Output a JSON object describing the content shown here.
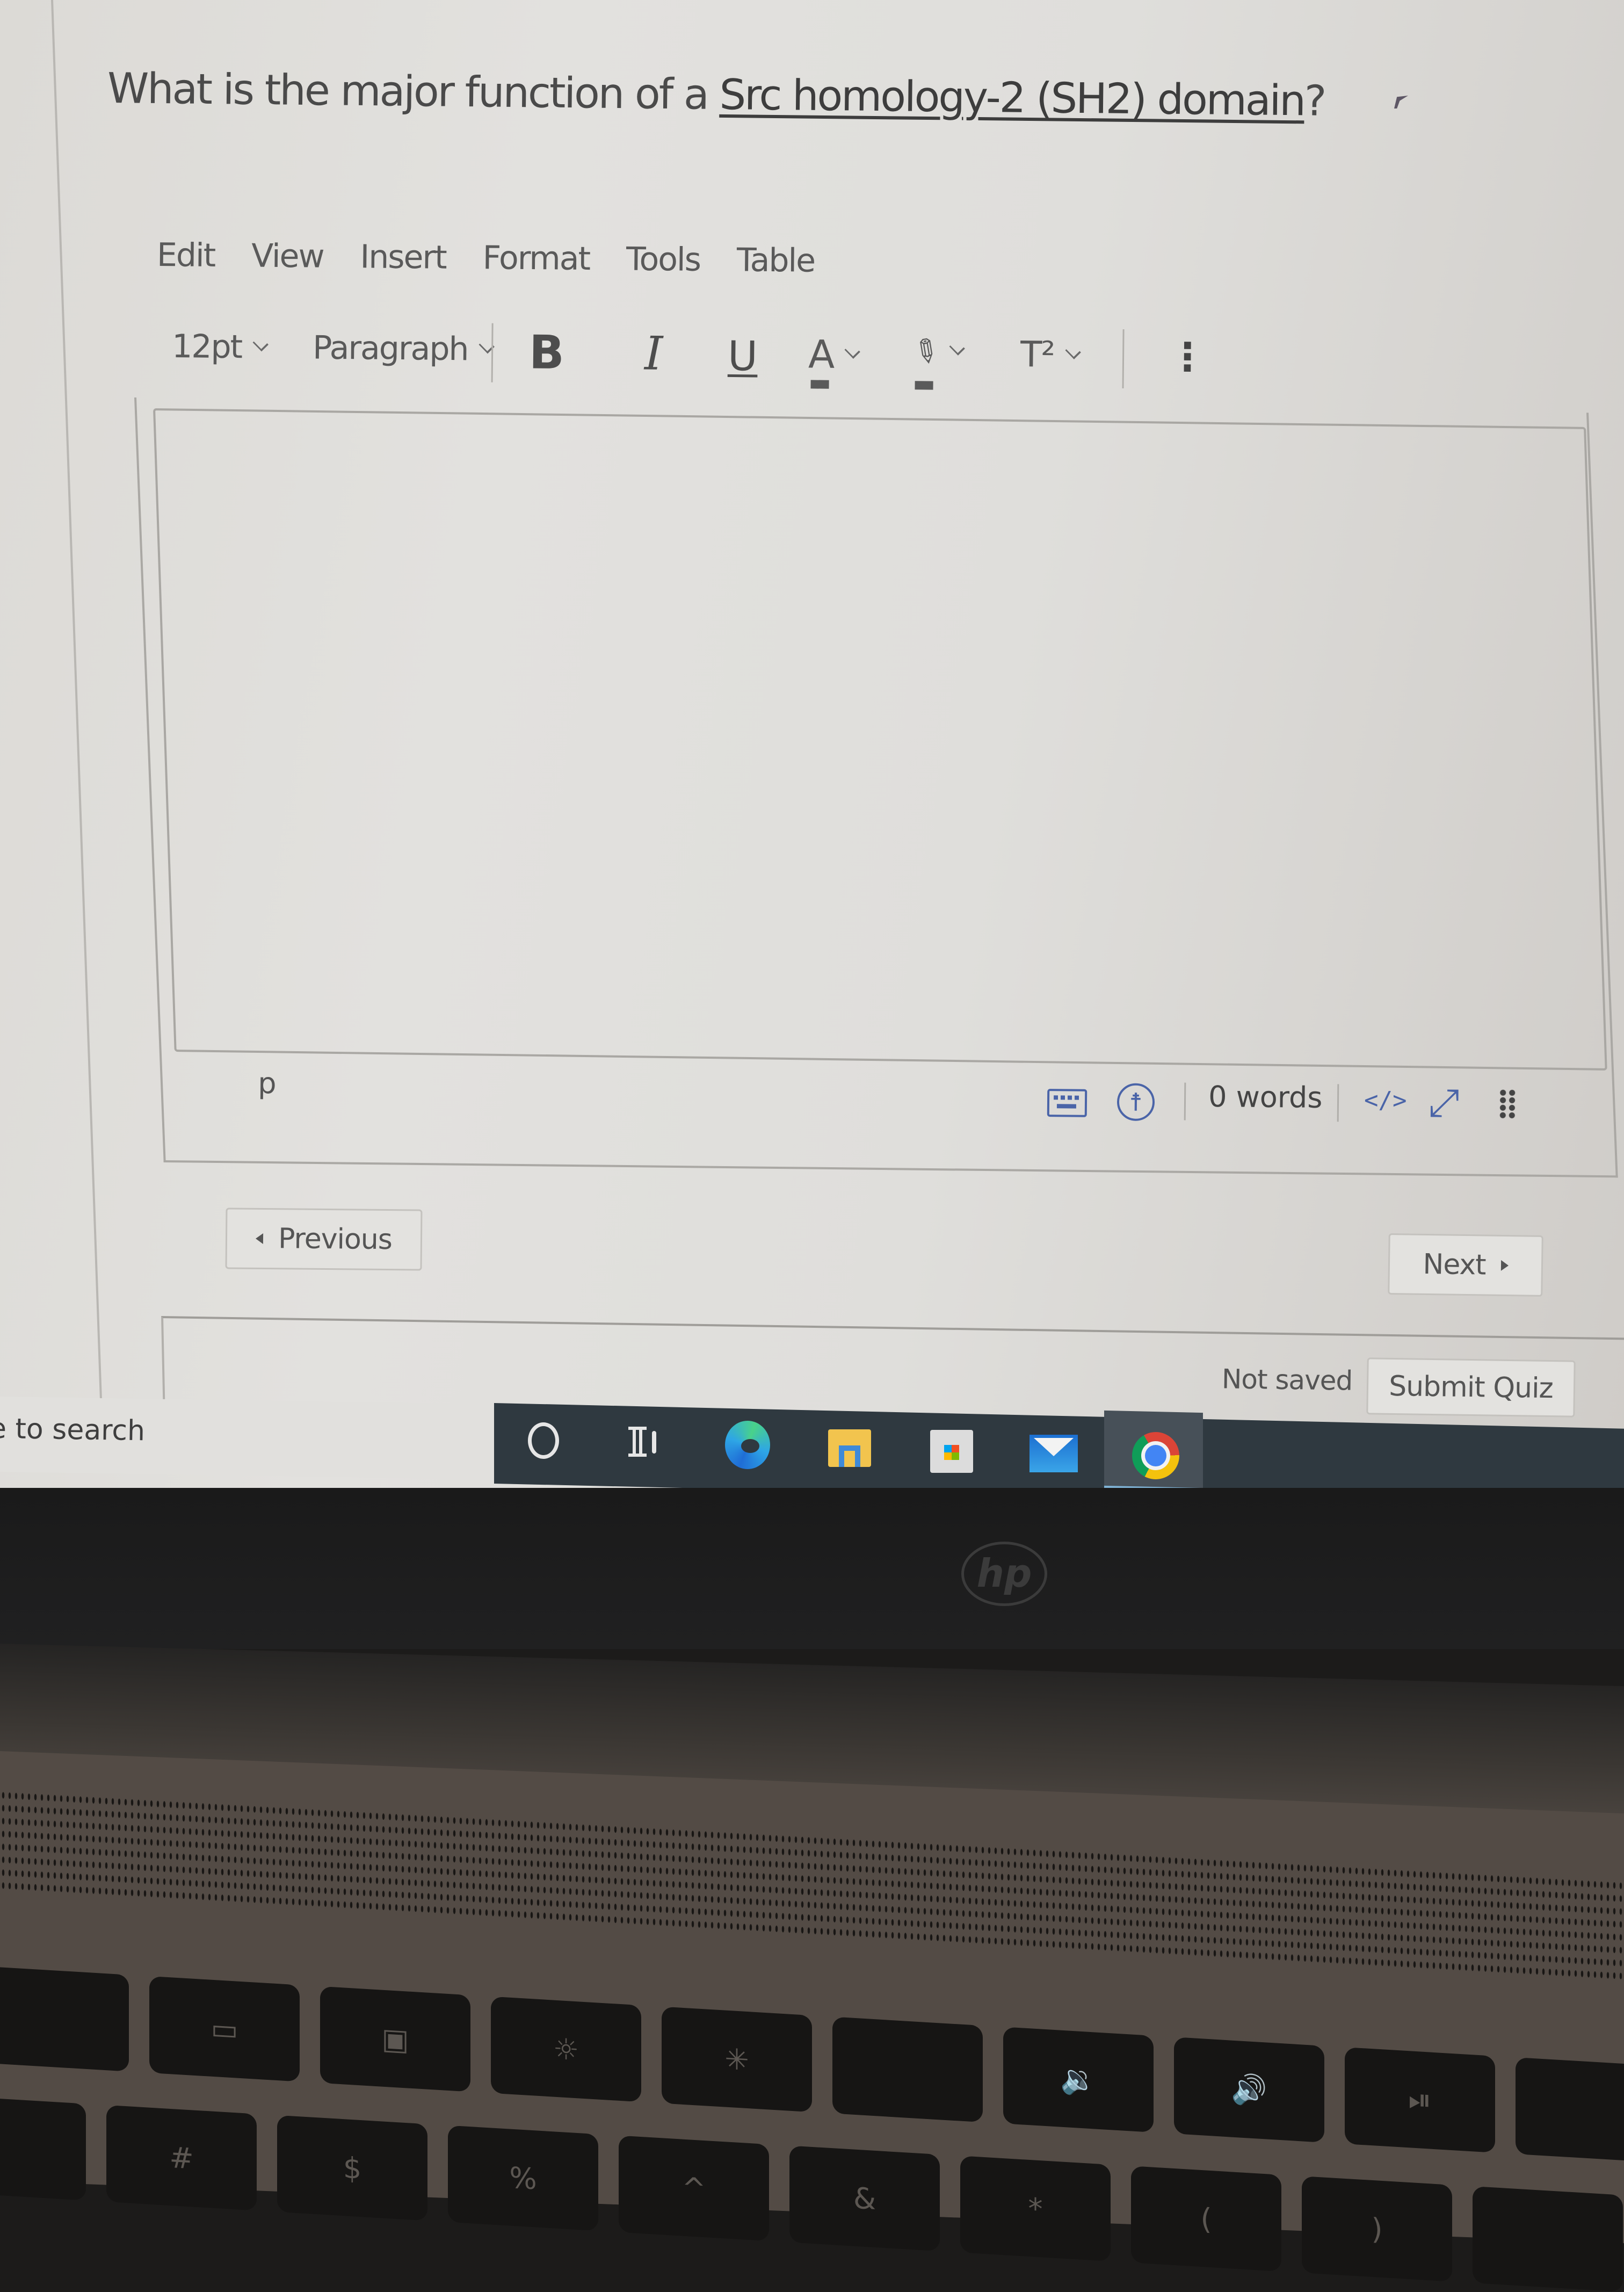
{
  "question": {
    "prefix": "What is the major function of a ",
    "link_text": "Src homology-2 (SH2) domain",
    "suffix": "?"
  },
  "editor": {
    "menu": [
      "Edit",
      "View",
      "Insert",
      "Format",
      "Tools",
      "Table"
    ],
    "toolbar": {
      "font_size": "12pt",
      "block_format": "Paragraph",
      "bold": "B",
      "italic": "I",
      "underline": "U",
      "text_color": "A",
      "highlight_icon": "highlighter-icon",
      "superscript": "T²",
      "more_icon": "more-vertical-icon"
    },
    "content": "",
    "status_bar": {
      "element_path": "p",
      "keyboard_icon": "keyboard-icon",
      "accessibility_icon": "accessibility-icon",
      "word_count": "0 words",
      "html_editor": "</>",
      "fullscreen_icon": "expand-icon",
      "resize_icon": "grip-icon"
    },
    "accent_color": "#4a64a8"
  },
  "navigation": {
    "previous_label": "Previous",
    "next_label": "Next"
  },
  "footer": {
    "save_status": "Not saved",
    "submit_label": "Submit Quiz"
  },
  "taskbar": {
    "search_placeholder": "e to search",
    "apps": [
      "cortana",
      "task-view",
      "microsoft-edge",
      "file-explorer",
      "microsoft-store",
      "mail",
      "google-chrome"
    ],
    "active_app": "google-chrome"
  },
  "laptop": {
    "brand": "hp",
    "function_keys": [
      "",
      "",
      "",
      "",
      "",
      "",
      "",
      "",
      "",
      ""
    ],
    "number_keys": [
      "",
      "#",
      "$",
      "%",
      "^",
      "&",
      "*",
      "(",
      ")",
      ""
    ]
  }
}
